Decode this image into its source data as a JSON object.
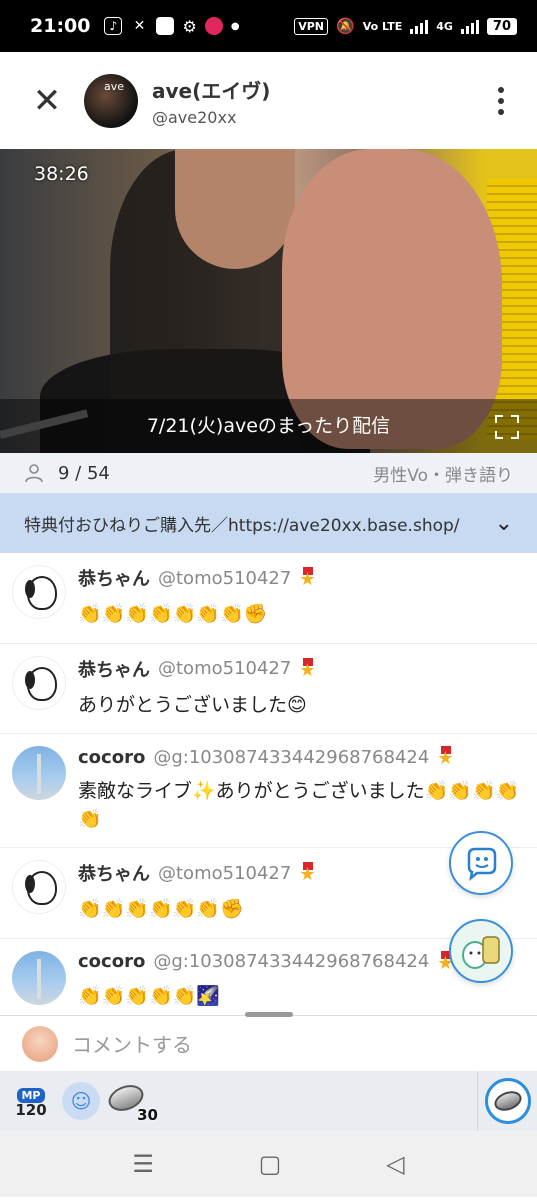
{
  "status_bar": {
    "time": "21:00",
    "vpn": "VPN",
    "lte": "Vo LTE",
    "network": "4G",
    "battery": "70"
  },
  "header": {
    "close_icon": "close-icon",
    "channel_name": "ave(エイヴ)",
    "channel_handle": "@ave20xx",
    "more_icon": "more-vertical-icon"
  },
  "video": {
    "elapsed": "38:26",
    "title": "7/21(火)aveのまったり配信"
  },
  "stats": {
    "viewers": "9 / 54",
    "genre": "男性Vo・弾き語り"
  },
  "notice": {
    "text": "特典付おひねりご購入先／https://ave20xx.base.shop/"
  },
  "comments": [
    {
      "name": "恭ちゃん",
      "handle": "@tomo510427",
      "avatar": "snoopy",
      "text": "👏👏👏👏👏👏👏✊"
    },
    {
      "name": "恭ちゃん",
      "handle": "@tomo510427",
      "avatar": "snoopy",
      "text": "ありがとうございました😊"
    },
    {
      "name": "cocoro",
      "handle": "@g:103087433442968768424",
      "avatar": "tower",
      "text": "素敵なライブ✨ありがとうございました👏👏👏👏👏"
    },
    {
      "name": "恭ちゃん",
      "handle": "@tomo510427",
      "avatar": "snoopy",
      "text": "👏👏👏👏👏👏✊"
    },
    {
      "name": "cocoro",
      "handle": "@g:103087433442968768424",
      "avatar": "tower",
      "text": "👏👏👏👏👏🌠"
    }
  ],
  "input": {
    "placeholder": "コメントする"
  },
  "actions": {
    "mp_label": "MP",
    "mp_value": "120",
    "coin_count": "30"
  },
  "colors": {
    "accent": "#3a8fd8",
    "notice_bg": "#c8d9f2",
    "stats_bg": "#eef1f5"
  }
}
